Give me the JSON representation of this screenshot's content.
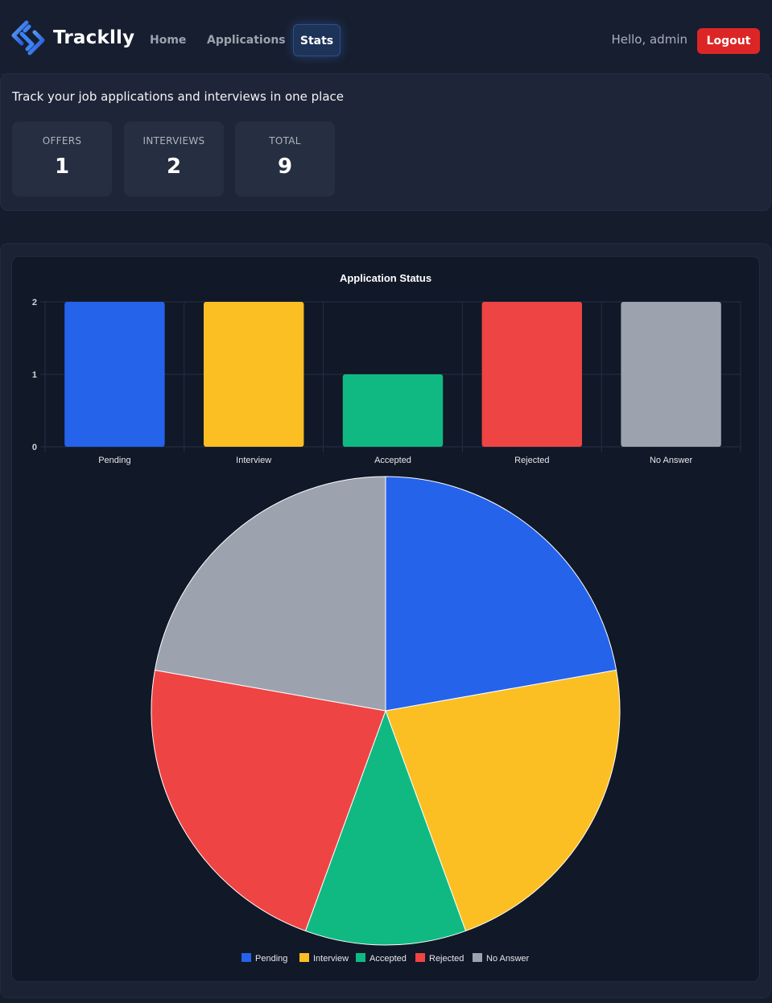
{
  "app": {
    "name": "Tracklly",
    "logo_icon": "diamond-chain-logo-icon"
  },
  "nav": {
    "items": [
      {
        "label": "Home"
      },
      {
        "label": "Applications"
      },
      {
        "label": "Stats",
        "active": true
      }
    ]
  },
  "user": {
    "greeting": "Hello, admin",
    "logout_label": "Logout"
  },
  "summary": {
    "tagline": "Track your job applications and interviews in one place",
    "cards": [
      {
        "label": "OFFERS",
        "value": "1"
      },
      {
        "label": "INTERVIEWS",
        "value": "2"
      },
      {
        "label": "TOTAL",
        "value": "9"
      }
    ]
  },
  "colors": {
    "accent": "#3b82f6",
    "logout": "#dc2626",
    "pending": "#2563eb",
    "interview": "#fbbf24",
    "accepted": "#10b981",
    "rejected": "#ef4444",
    "no_answer": "#9ca3af"
  },
  "chart_data": [
    {
      "type": "bar",
      "title": "Application Status",
      "categories": [
        "Pending",
        "Interview",
        "Accepted",
        "Rejected",
        "No Answer"
      ],
      "values": [
        2,
        2,
        1,
        2,
        2
      ],
      "colors": [
        "#2563eb",
        "#fbbf24",
        "#10b981",
        "#ef4444",
        "#9ca3af"
      ],
      "ylim": [
        0,
        2
      ],
      "yticks": [
        0,
        1,
        2
      ],
      "grid": true,
      "legend": "none"
    },
    {
      "type": "pie",
      "categories": [
        "Pending",
        "Interview",
        "Accepted",
        "Rejected",
        "No Answer"
      ],
      "values": [
        2,
        2,
        1,
        2,
        2
      ],
      "colors": [
        "#2563eb",
        "#fbbf24",
        "#10b981",
        "#ef4444",
        "#9ca3af"
      ],
      "legend": "bottom"
    }
  ]
}
